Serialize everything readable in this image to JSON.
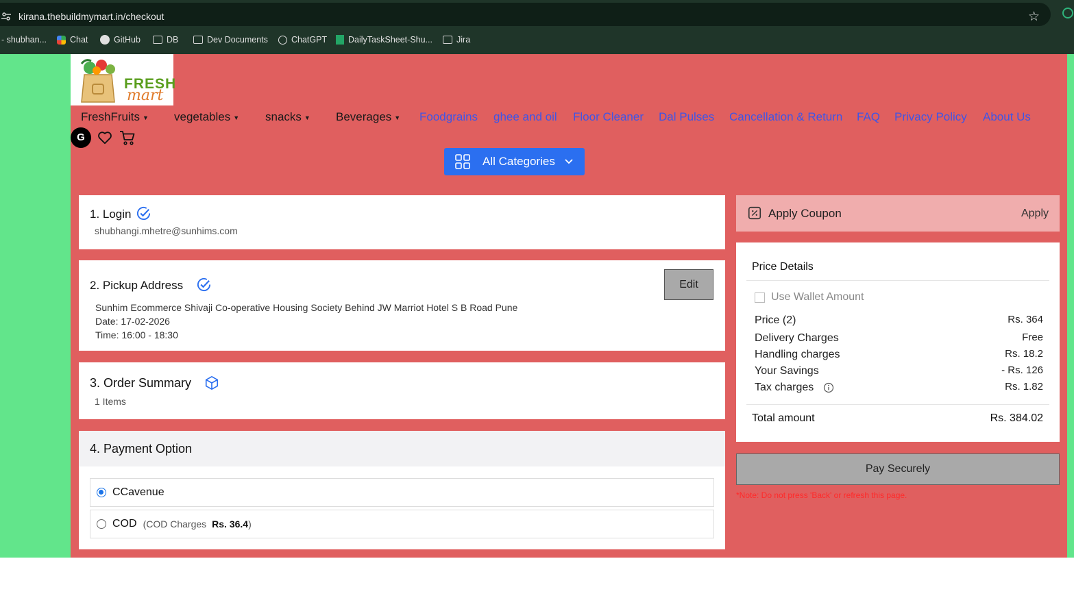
{
  "browser": {
    "url": "kirana.thebuildmymart.in/checkout",
    "bookmarks": [
      "- shubhan...",
      "Chat",
      "GitHub",
      "DB",
      "Dev Documents",
      "ChatGPT",
      "DailyTaskSheet-Shu...",
      "Jira"
    ]
  },
  "logo": {
    "line1": "FRESH",
    "line2": "mart"
  },
  "nav": {
    "dropdowns": [
      "FreshFruits",
      "vegetables",
      "snacks",
      "Beverages"
    ],
    "links": [
      "Foodgrains",
      "ghee and oil",
      "Floor Cleaner",
      "Dal Pulses",
      "Cancellation & Return",
      "FAQ",
      "Privacy Policy",
      "About Us"
    ],
    "avatar_letter": "G",
    "categories_label": "All Categories"
  },
  "checkout": {
    "login": {
      "title": "1. Login",
      "email": "shubhangi.mhetre@sunhims.com"
    },
    "pickup": {
      "title": "2. Pickup Address",
      "edit_label": "Edit",
      "address": "Sunhim Ecommerce Shivaji Co-operative Housing Society Behind JW Marriot Hotel S B Road Pune",
      "date": "Date: 17-02-2026",
      "time": "Time: 16:00 - 18:30"
    },
    "summary": {
      "title": "3. Order Summary",
      "items": "1 Items"
    },
    "payment": {
      "title": "4. Payment Option",
      "options": [
        {
          "label": "CCavenue",
          "selected": true
        },
        {
          "label": "COD",
          "note_prefix": "(COD Charges",
          "note_value": "Rs. 36.4",
          "note_suffix": ")",
          "selected": false
        }
      ]
    }
  },
  "sidebar": {
    "coupon_label": "Apply Coupon",
    "coupon_action": "Apply",
    "price_details_title": "Price Details",
    "wallet_label": "Use Wallet Amount",
    "rows": [
      {
        "label": "Price (2)",
        "value": "Rs. 364"
      },
      {
        "label": "Delivery Charges",
        "value": "Free"
      },
      {
        "label": "Handling charges",
        "value": "Rs. 18.2"
      },
      {
        "label": "Your Savings",
        "value": "- Rs. 126"
      },
      {
        "label": "Tax charges",
        "value": "Rs. 1.82"
      }
    ],
    "total_label": "Total amount",
    "total_value": "Rs. 384.02",
    "pay_label": "Pay Securely",
    "note": "*Note: Do not press 'Back' or refresh this page."
  },
  "colors": {
    "page_bg": "#e05f5f",
    "side_bg": "#62e58b",
    "primary": "#2b6ff0",
    "link": "#3f55e6",
    "note": "#ff2a2a"
  }
}
